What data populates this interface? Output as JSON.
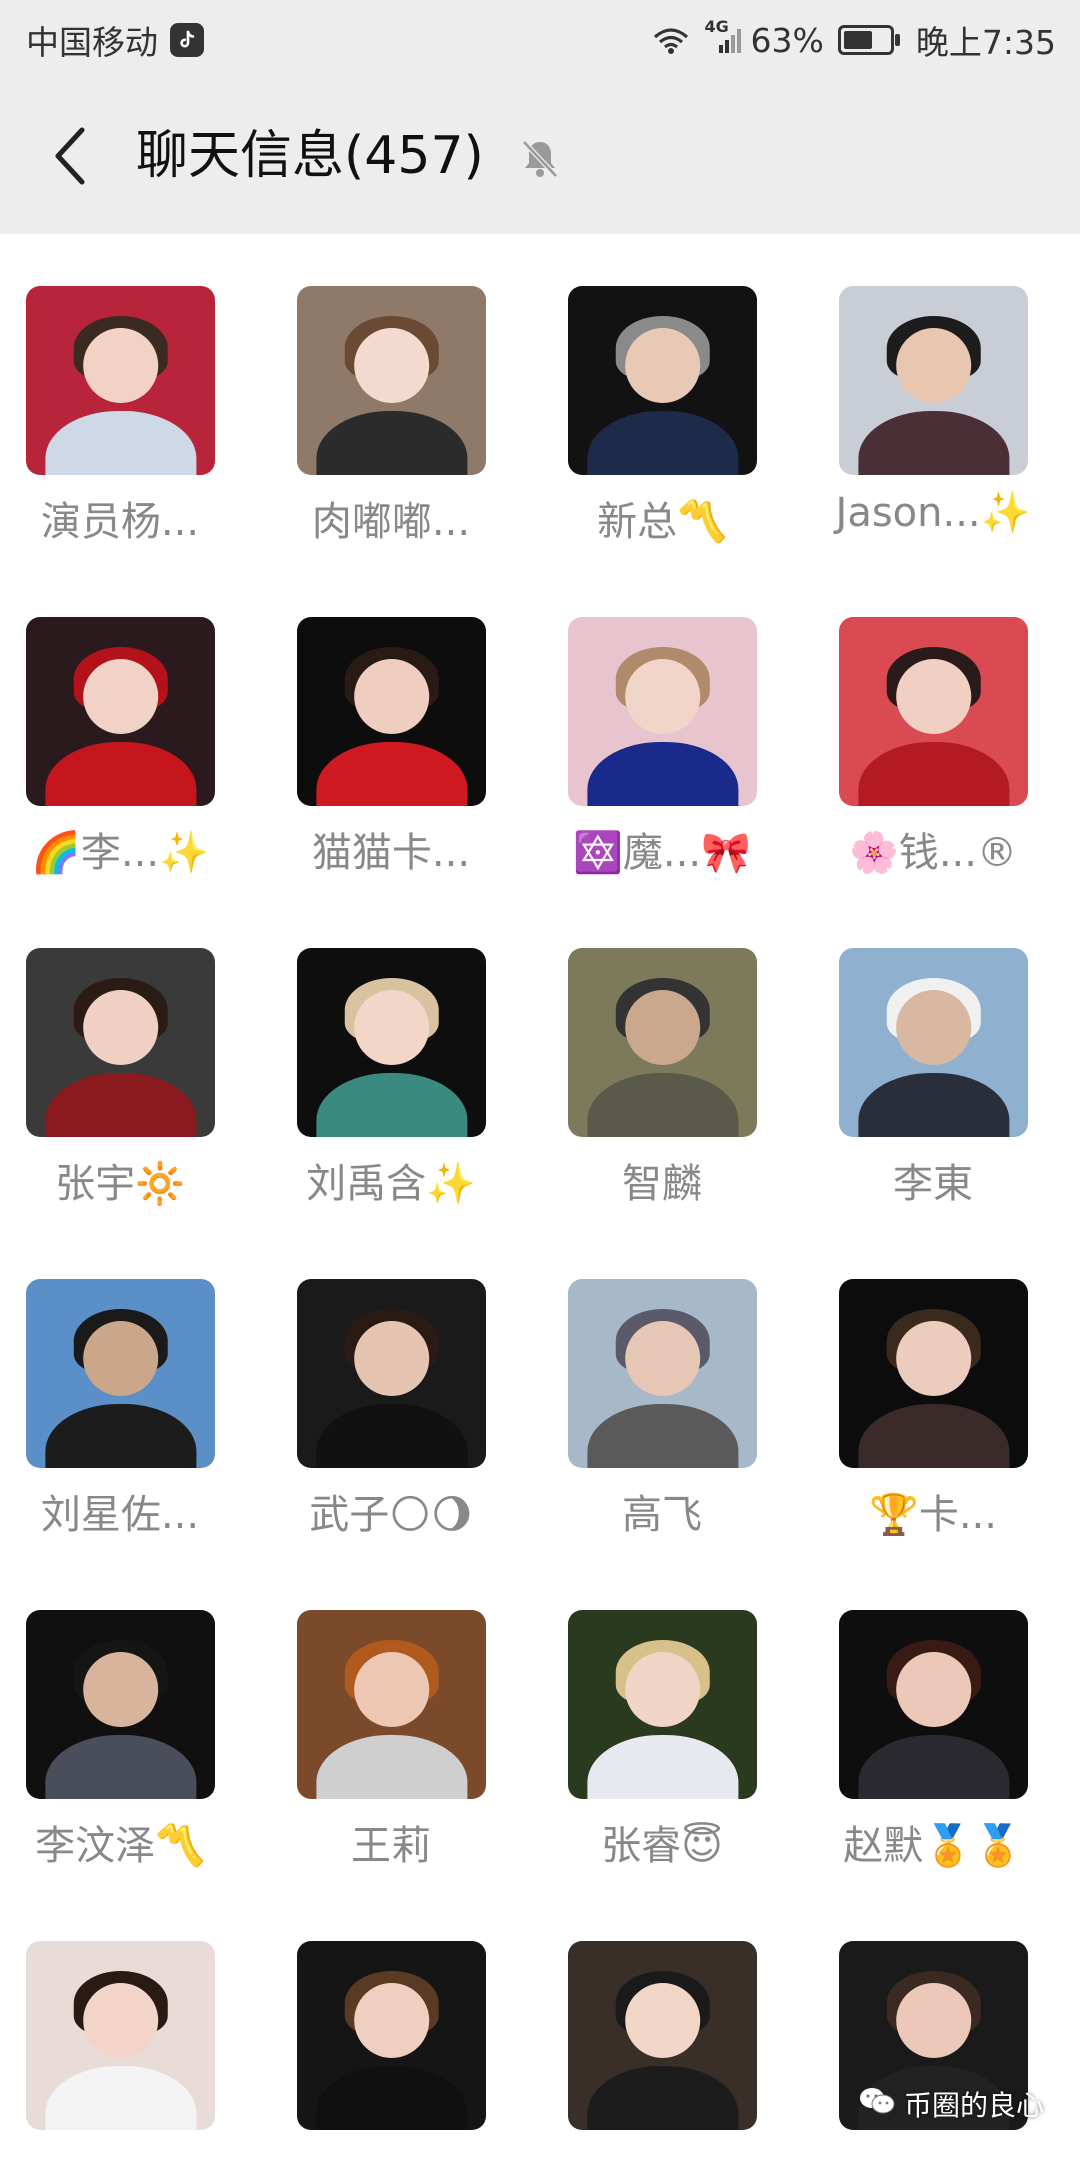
{
  "status_bar": {
    "carrier": "中国移动",
    "network": "4G",
    "battery": "63%",
    "battery_level": 0.63,
    "time": "晚上7:35"
  },
  "header": {
    "title": "聊天信息(457)"
  },
  "members": [
    {
      "name": "演员杨...",
      "bg": "#b8243a",
      "skin": "#f2d2c4",
      "cloth": "#cfd8e6",
      "hair": "#3a2a22"
    },
    {
      "name": "肉嘟嘟...",
      "bg": "#8f7a6a",
      "skin": "#f4d9cf",
      "cloth": "#2b2b2b",
      "hair": "#6a4a32"
    },
    {
      "name": "新总〽️",
      "bg": "#121212",
      "skin": "#e7c9b5",
      "cloth": "#1e2a4a",
      "hair": "#8a8a8a"
    },
    {
      "name": "Jason...✨",
      "bg": "#c9ced6",
      "skin": "#e8c6b0",
      "cloth": "#4a3036",
      "hair": "#1c1c1c"
    },
    {
      "name": "🌈李...✨",
      "bg": "#2a1a1e",
      "skin": "#f0d2c6",
      "cloth": "#c4161c",
      "hair": "#b3121a"
    },
    {
      "name": "猫猫卡...",
      "bg": "#0d0d0d",
      "skin": "#efcdbf",
      "cloth": "#d01a22",
      "hair": "#2a1a14"
    },
    {
      "name": "🔯魔...🎀",
      "bg": "#e8c4cf",
      "skin": "#f1d5c8",
      "cloth": "#1a2a8a",
      "hair": "#b08a6a"
    },
    {
      "name": "🌸钱...®",
      "bg": "#d94a52",
      "skin": "#f0d0c2",
      "cloth": "#b31a22",
      "hair": "#2a1a1a"
    },
    {
      "name": "张宇🔆",
      "bg": "#3a3a3a",
      "skin": "#efd0c3",
      "cloth": "#8a1a1e",
      "hair": "#2a1c14"
    },
    {
      "name": "刘禹含✨",
      "bg": "#0e0e0e",
      "skin": "#f2d6c8",
      "cloth": "#3a8a80",
      "hair": "#d8c2a0"
    },
    {
      "name": "智麟",
      "bg": "#7c7a5a",
      "skin": "#caa88e",
      "cloth": "#5a5a4a",
      "hair": "#333333"
    },
    {
      "name": "李東",
      "bg": "#8fb0cf",
      "skin": "#d8b8a0",
      "cloth": "#2a2e3a",
      "hair": "#f0f0f0"
    },
    {
      "name": "刘星佐...",
      "bg": "#5a8fc8",
      "skin": "#caa68a",
      "cloth": "#1c1c1c",
      "hair": "#1a1a1a"
    },
    {
      "name": "武子🌕🌖",
      "bg": "#1a1a1a",
      "skin": "#e6c4b2",
      "cloth": "#111111",
      "hair": "#2a1a14"
    },
    {
      "name": "高飞",
      "bg": "#a7b8c8",
      "skin": "#e6c6b4",
      "cloth": "#5a5a5a",
      "hair": "#5a5a6a"
    },
    {
      "name": "🏆卡...",
      "bg": "#0c0c0c",
      "skin": "#ecccbd",
      "cloth": "#3a2a2a",
      "hair": "#3a2a1e"
    },
    {
      "name": "李汶泽〽️",
      "bg": "#101010",
      "skin": "#d8b49c",
      "cloth": "#4a4e5a",
      "hair": "#151515"
    },
    {
      "name": "王莉",
      "bg": "#7a4a2a",
      "skin": "#ecc8b4",
      "cloth": "#cfcfcf",
      "hair": "#b05a1e"
    },
    {
      "name": "张睿😇",
      "bg": "#2a3a1e",
      "skin": "#f0d4c6",
      "cloth": "#e8e8f0",
      "hair": "#d8c08a"
    },
    {
      "name": "赵默🏅🏅",
      "bg": "#0e0e0e",
      "skin": "#ecc8b8",
      "cloth": "#2a2a30",
      "hair": "#3a1a14"
    },
    {
      "name": "",
      "bg": "#e9dcd8",
      "skin": "#f3d4c8",
      "cloth": "#f4f4f4",
      "hair": "#2a1a14"
    },
    {
      "name": "",
      "bg": "#151515",
      "skin": "#efcfc0",
      "cloth": "#101010",
      "hair": "#5a3a22"
    },
    {
      "name": "",
      "bg": "#3a2e28",
      "skin": "#f2d6c8",
      "cloth": "#1c1c1c",
      "hair": "#1a1a1a"
    },
    {
      "name": "",
      "bg": "#1a1a1a",
      "skin": "#ecc8b8",
      "cloth": "#222222",
      "hair": "#3a2a22"
    }
  ],
  "watermark": "币圈的良心"
}
